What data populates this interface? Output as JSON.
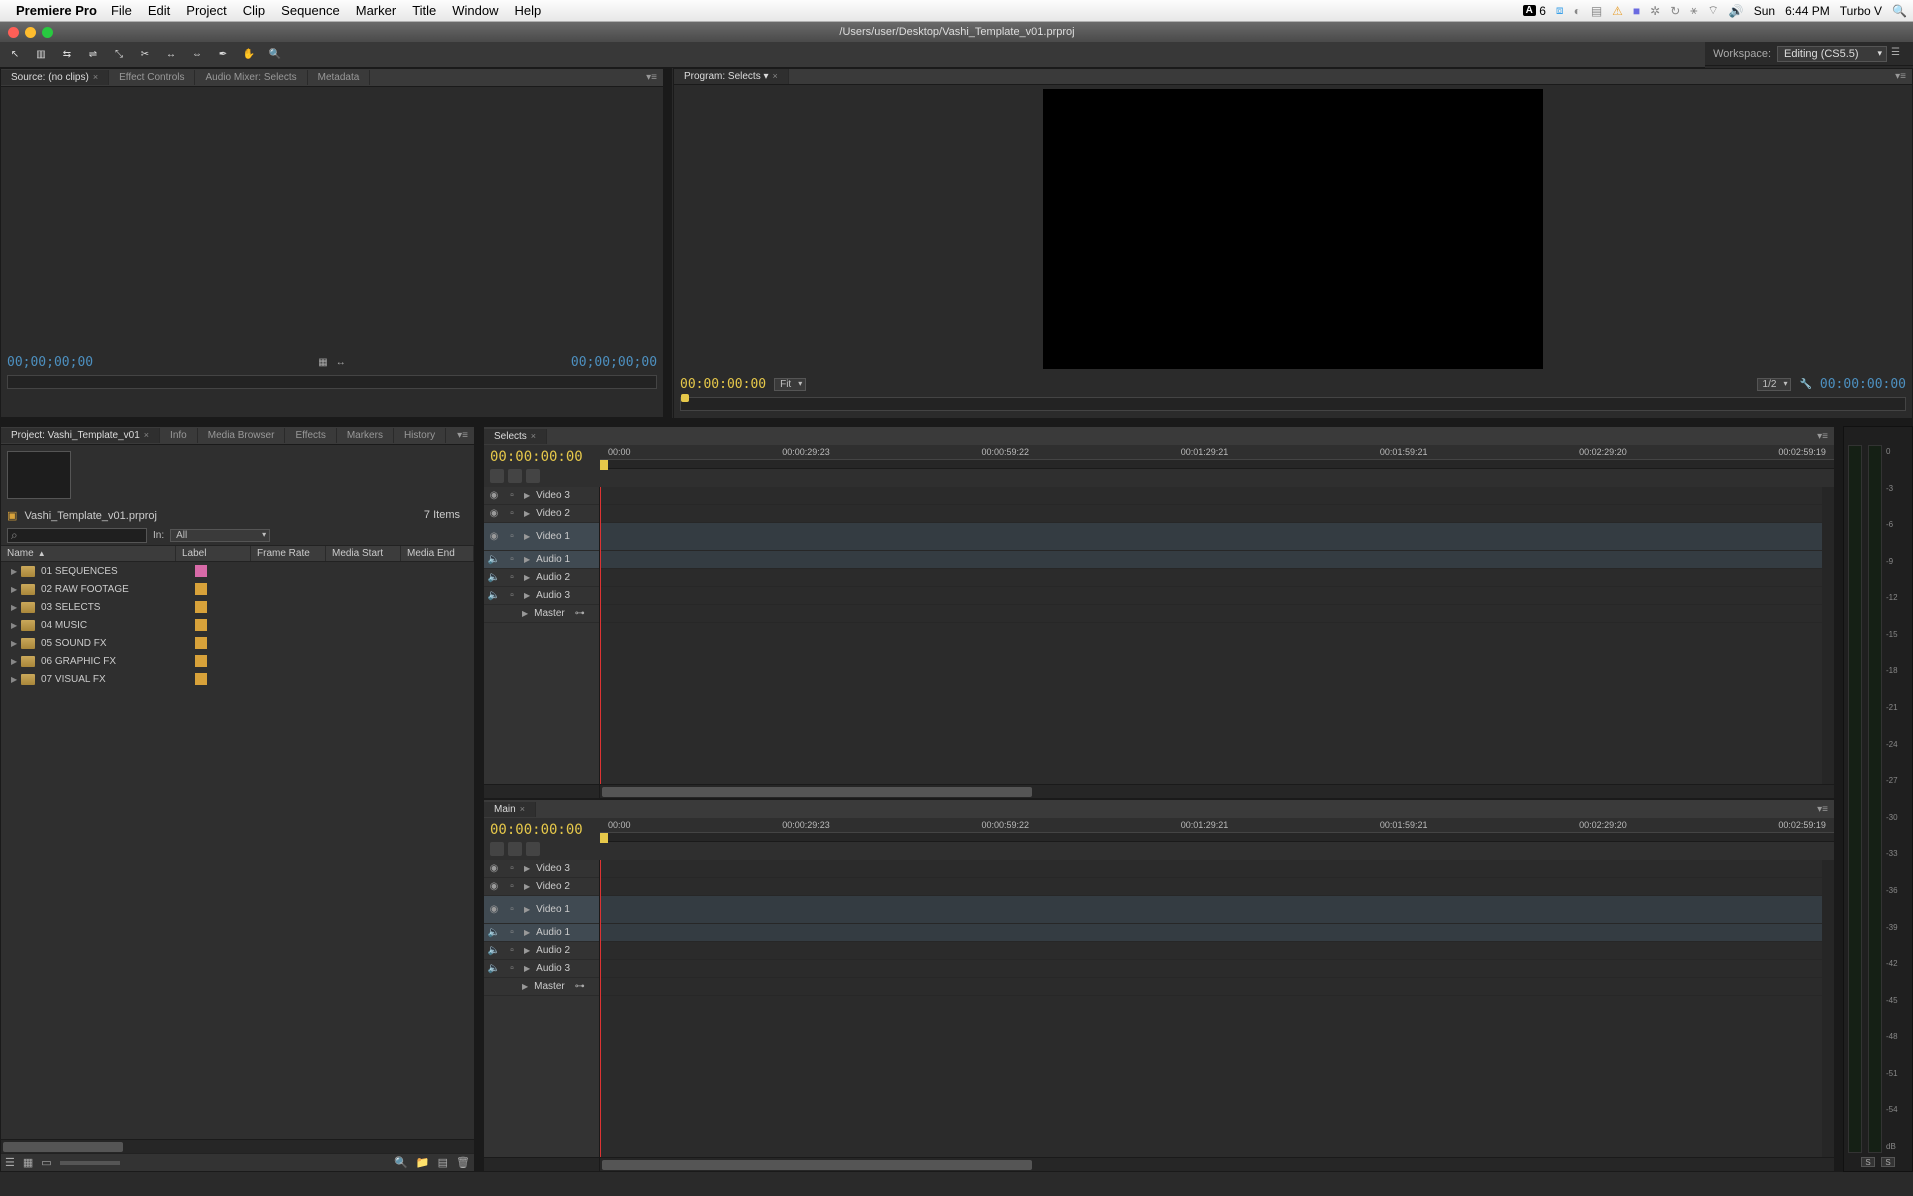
{
  "mac_menu": {
    "app": "Premiere Pro",
    "items": [
      "File",
      "Edit",
      "Project",
      "Clip",
      "Sequence",
      "Marker",
      "Title",
      "Window",
      "Help"
    ],
    "adobe_badge": "A",
    "adobe_num": "6",
    "clock_day": "Sun",
    "clock_time": "6:44 PM",
    "user": "Turbo V"
  },
  "window_title": "/Users/user/Desktop/Vashi_Template_v01.prproj",
  "workspace": {
    "label": "Workspace:",
    "value": "Editing (CS5.5)"
  },
  "source_panel": {
    "tabs": [
      "Source: (no clips)",
      "Effect Controls",
      "Audio Mixer: Selects",
      "Metadata"
    ],
    "tc_left": "00;00;00;00",
    "tc_right": "00;00;00;00"
  },
  "program_panel": {
    "tab": "Program: Selects",
    "tc_left": "00:00:00:00",
    "fit": "Fit",
    "half": "1/2",
    "tc_right": "00:00:00:00"
  },
  "project_panel": {
    "tabs": [
      "Project: Vashi_Template_v01",
      "Info",
      "Media Browser",
      "Effects",
      "Markers",
      "History"
    ],
    "filename": "Vashi_Template_v01.prproj",
    "items_count": "7 Items",
    "in_label": "In:",
    "in_value": "All",
    "columns": [
      "Name",
      "Label",
      "Frame Rate",
      "Media Start",
      "Media End"
    ],
    "bins": [
      {
        "name": "01 SEQUENCES",
        "color": "#d86aa8"
      },
      {
        "name": "02 RAW FOOTAGE",
        "color": "#d8a23a"
      },
      {
        "name": "03 SELECTS",
        "color": "#d8a23a"
      },
      {
        "name": "04 MUSIC",
        "color": "#d8a23a"
      },
      {
        "name": "05 SOUND FX",
        "color": "#d8a23a"
      },
      {
        "name": "06 GRAPHIC FX",
        "color": "#d8a23a"
      },
      {
        "name": "07 VISUAL FX",
        "color": "#d8a23a"
      }
    ]
  },
  "timelines": [
    {
      "name": "Selects",
      "tc": "00:00:00:00",
      "ruler": [
        "00:00",
        "00:00:29:23",
        "00:00:59:22",
        "00:01:29:21",
        "00:01:59:21",
        "00:02:29:20",
        "00:02:59:19"
      ],
      "video_tracks": [
        "Video 3",
        "Video 2",
        "Video 1"
      ],
      "audio_tracks": [
        "Audio 1",
        "Audio 2",
        "Audio 3"
      ],
      "master": "Master"
    },
    {
      "name": "Main",
      "tc": "00:00:00:00",
      "ruler": [
        "00:00",
        "00:00:29:23",
        "00:00:59:22",
        "00:01:29:21",
        "00:01:59:21",
        "00:02:29:20",
        "00:02:59:19"
      ],
      "video_tracks": [
        "Video 3",
        "Video 2",
        "Video 1"
      ],
      "audio_tracks": [
        "Audio 1",
        "Audio 2",
        "Audio 3"
      ],
      "master": "Master"
    }
  ],
  "meter_ticks": [
    "0",
    "-3",
    "-6",
    "-9",
    "-12",
    "-15",
    "-18",
    "-21",
    "-24",
    "-27",
    "-30",
    "-33",
    "-36",
    "-39",
    "-42",
    "-45",
    "-48",
    "-51",
    "-54",
    "dB"
  ],
  "meter_solo": "S"
}
